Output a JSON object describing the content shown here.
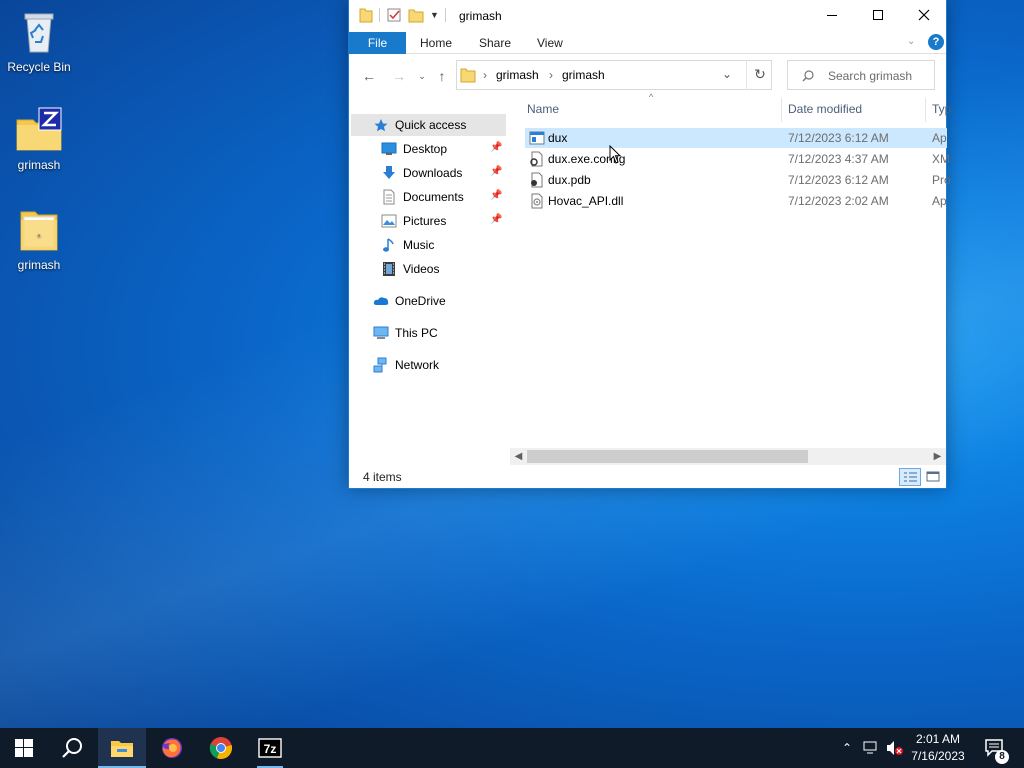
{
  "desktop": {
    "icons": [
      {
        "label": "Recycle Bin"
      },
      {
        "label": "grimash"
      },
      {
        "label": "grimash"
      }
    ]
  },
  "window": {
    "title": "grimash",
    "ribbon_tabs": [
      "File",
      "Home",
      "Share",
      "View"
    ],
    "address": {
      "segments": [
        "grimash",
        "grimash"
      ]
    },
    "search_placeholder": "Search grimash",
    "nav": {
      "quick_access": "Quick access",
      "items": [
        "Desktop",
        "Downloads",
        "Documents",
        "Pictures",
        "Music",
        "Videos"
      ],
      "onedrive": "OneDrive",
      "this_pc": "This PC",
      "network": "Network"
    },
    "columns": {
      "name": "Name",
      "date": "Date modified",
      "type": "Typ"
    },
    "files": [
      {
        "name": "dux",
        "date": "7/12/2023 6:12 AM",
        "type": "Ap",
        "icon": "application-icon"
      },
      {
        "name": "dux.exe.config",
        "date": "7/12/2023 4:37 AM",
        "type": "XM",
        "icon": "config-file-icon"
      },
      {
        "name": "dux.pdb",
        "date": "7/12/2023 6:12 AM",
        "type": "Pro",
        "icon": "pdb-file-icon"
      },
      {
        "name": "Hovac_API.dll",
        "date": "7/12/2023 2:02 AM",
        "type": "Ap",
        "icon": "dll-file-icon"
      }
    ],
    "status": "4 items"
  },
  "taskbar": {
    "clock_time": "2:01 AM",
    "clock_date": "7/16/2023",
    "notification_count": "8",
    "pinned": [
      "start",
      "search",
      "file-explorer",
      "firefox",
      "chrome",
      "7-zip"
    ]
  },
  "colors": {
    "accent": "#1979ca",
    "selection": "#cce8ff",
    "taskbar": "#101b2a"
  }
}
